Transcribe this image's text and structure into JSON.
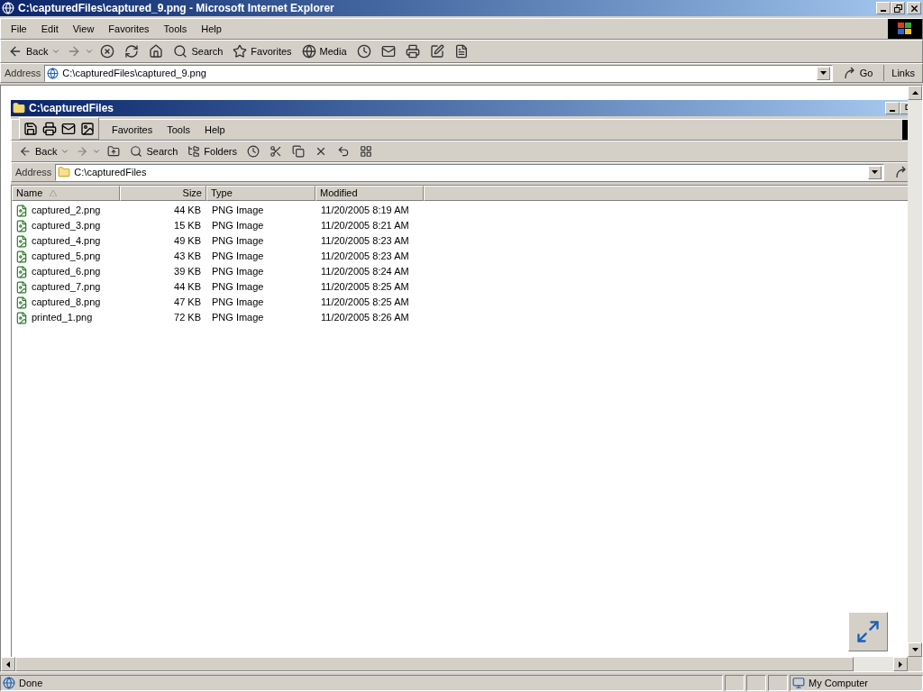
{
  "window": {
    "title": "C:\\capturedFiles\\captured_9.png - Microsoft Internet Explorer"
  },
  "menu": [
    "File",
    "Edit",
    "View",
    "Favorites",
    "Tools",
    "Help"
  ],
  "toolbar": [
    {
      "kind": "back",
      "label": "Back"
    },
    {
      "kind": "forward"
    },
    {
      "kind": "stop"
    },
    {
      "kind": "refresh"
    },
    {
      "kind": "home"
    },
    {
      "kind": "search",
      "label": "Search"
    },
    {
      "kind": "favorites",
      "label": "Favorites"
    },
    {
      "kind": "media",
      "label": "Media"
    },
    {
      "kind": "history"
    },
    {
      "kind": "mail"
    },
    {
      "kind": "print"
    },
    {
      "kind": "edit"
    },
    {
      "kind": "discuss"
    }
  ],
  "address": {
    "label": "Address",
    "value": "C:\\capturedFiles\\captured_9.png",
    "go": "Go",
    "links": "Links"
  },
  "explorer": {
    "title": "C:\\capturedFiles",
    "menu": [
      "Favorites",
      "Tools",
      "Help"
    ],
    "toolbar": [
      {
        "kind": "back",
        "label": "Back"
      },
      {
        "kind": "forward"
      },
      {
        "kind": "up"
      },
      {
        "kind": "search",
        "label": "Search"
      },
      {
        "kind": "folders",
        "label": "Folders"
      },
      {
        "kind": "history"
      },
      {
        "kind": "move"
      },
      {
        "kind": "copy"
      },
      {
        "kind": "delete"
      },
      {
        "kind": "undo"
      },
      {
        "kind": "views"
      }
    ],
    "address": {
      "label": "Address",
      "value": "C:\\capturedFiles"
    },
    "columns": [
      {
        "label": "Name",
        "sorted": true
      },
      {
        "label": "Size",
        "sorted": false
      },
      {
        "label": "Type",
        "sorted": false
      },
      {
        "label": "Modified",
        "sorted": false
      }
    ],
    "rows": [
      {
        "name": "captured_2.png",
        "size": "44 KB",
        "type": "PNG Image",
        "modified": "11/20/2005 8:19 AM"
      },
      {
        "name": "captured_3.png",
        "size": "15 KB",
        "type": "PNG Image",
        "modified": "11/20/2005 8:21 AM"
      },
      {
        "name": "captured_4.png",
        "size": "49 KB",
        "type": "PNG Image",
        "modified": "11/20/2005 8:23 AM"
      },
      {
        "name": "captured_5.png",
        "size": "43 KB",
        "type": "PNG Image",
        "modified": "11/20/2005 8:23 AM"
      },
      {
        "name": "captured_6.png",
        "size": "39 KB",
        "type": "PNG Image",
        "modified": "11/20/2005 8:24 AM"
      },
      {
        "name": "captured_7.png",
        "size": "44 KB",
        "type": "PNG Image",
        "modified": "11/20/2005 8:25 AM"
      },
      {
        "name": "captured_8.png",
        "size": "47 KB",
        "type": "PNG Image",
        "modified": "11/20/2005 8:25 AM"
      },
      {
        "name": "printed_1.png",
        "size": "72 KB",
        "type": "PNG Image",
        "modified": "11/20/2005 8:26 AM"
      }
    ]
  },
  "status": {
    "text": "Done",
    "zone": "My Computer"
  }
}
